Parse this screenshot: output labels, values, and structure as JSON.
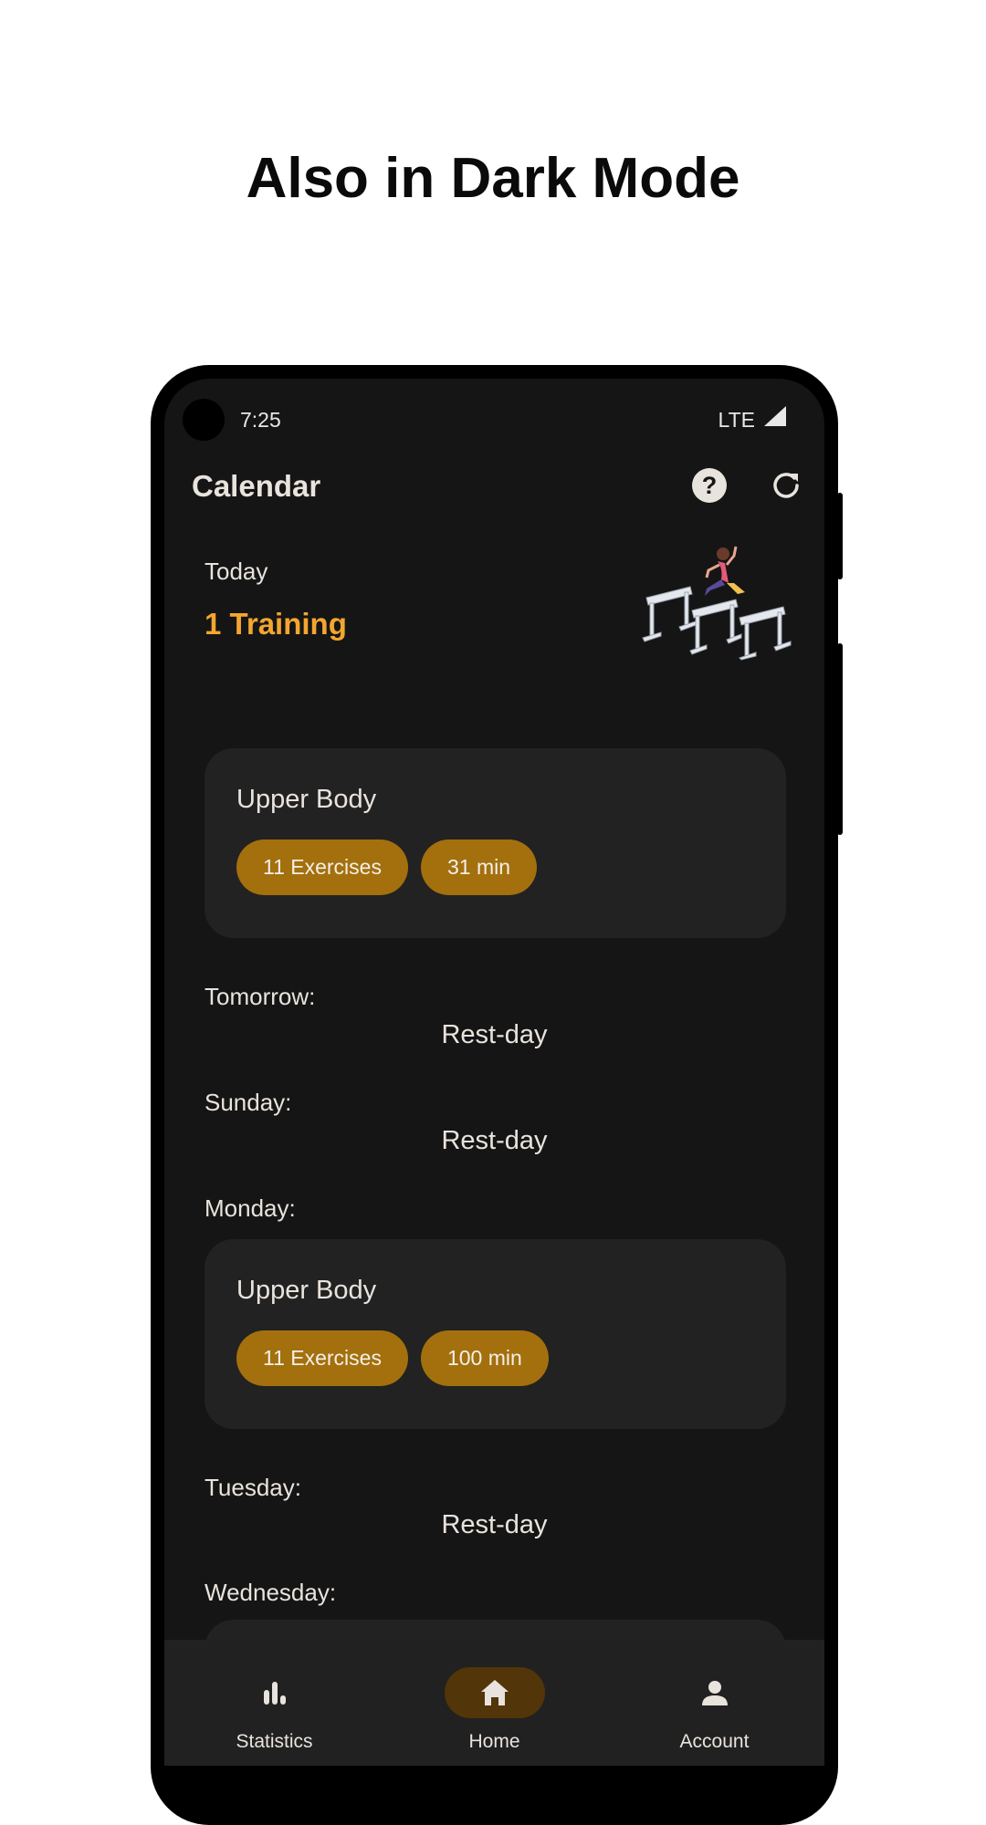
{
  "headline": "Also in Dark Mode",
  "status_bar": {
    "time": "7:25",
    "network": "LTE"
  },
  "app_bar": {
    "title": "Calendar"
  },
  "today": {
    "label": "Today",
    "count": "1 Training"
  },
  "today_card": {
    "title": "Upper Body",
    "exercises": "11 Exercises",
    "duration": "31 min"
  },
  "days": [
    {
      "label": "Tomorrow:",
      "status": "Rest-day"
    },
    {
      "label": "Sunday:",
      "status": "Rest-day"
    },
    {
      "label": "Monday:"
    },
    {
      "label": "Tuesday:",
      "status": "Rest-day"
    },
    {
      "label": "Wednesday:"
    }
  ],
  "monday_card": {
    "title": "Upper Body",
    "exercises": "11 Exercises",
    "duration": "100 min"
  },
  "nav": [
    {
      "label": "Statistics",
      "icon": "bar-chart-icon",
      "active": false
    },
    {
      "label": "Home",
      "icon": "home-icon",
      "active": true
    },
    {
      "label": "Account",
      "icon": "person-icon",
      "active": false
    }
  ],
  "colors": {
    "accent": "#f3a62f",
    "chip": "#a3700d",
    "background": "#151515",
    "surface": "#222222"
  }
}
